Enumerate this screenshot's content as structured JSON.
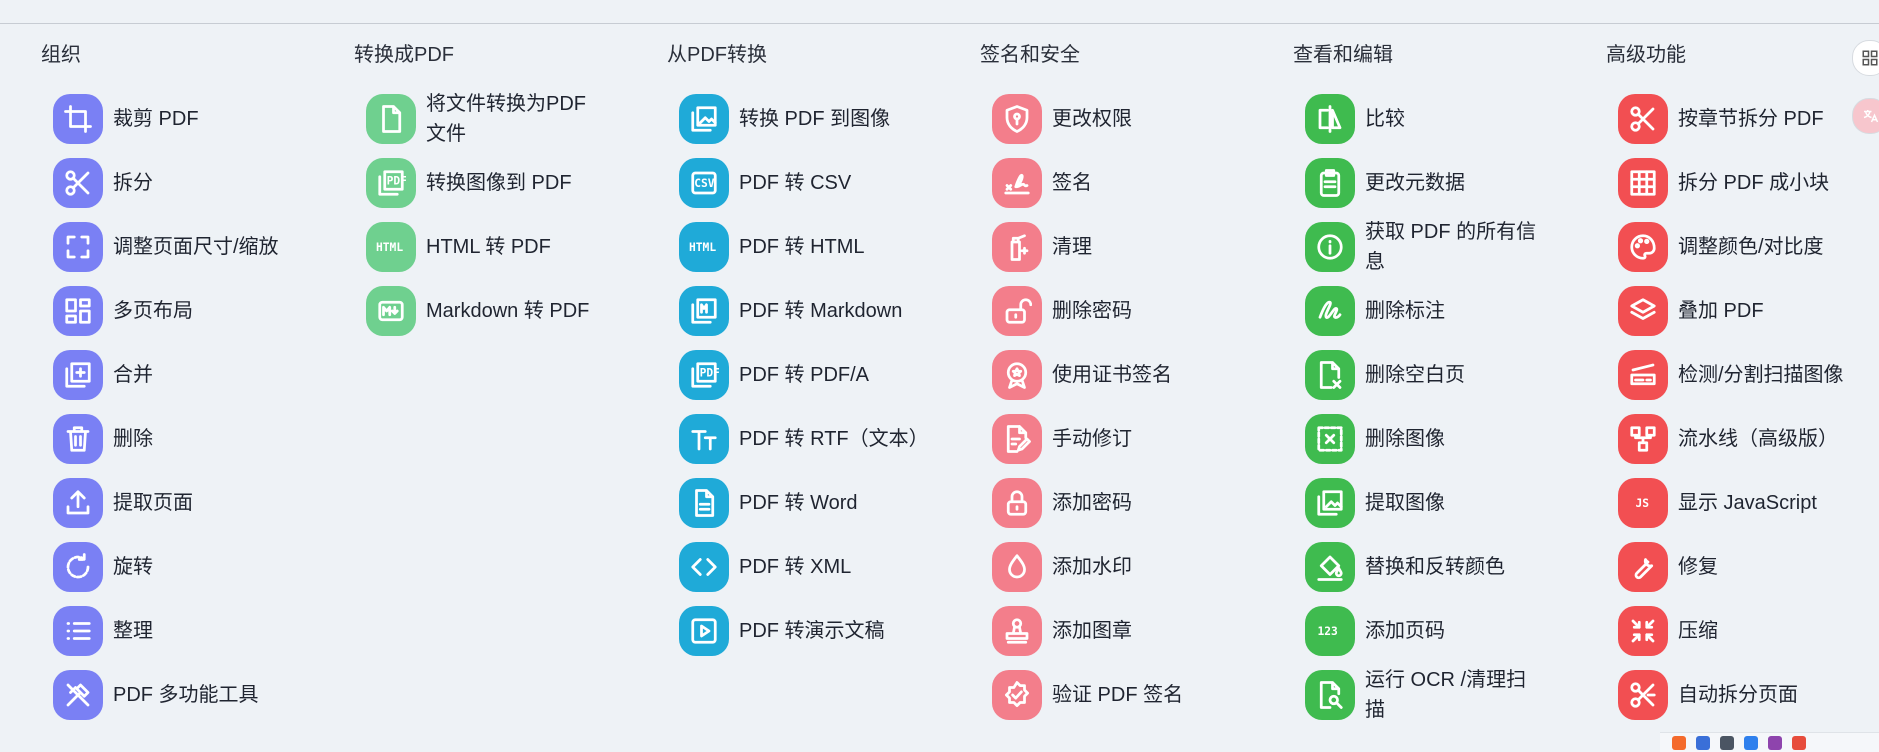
{
  "columns": [
    {
      "title": "组织",
      "items": [
        {
          "label": "裁剪 PDF",
          "icon": "crop-icon"
        },
        {
          "label": "拆分",
          "icon": "scissors-icon"
        },
        {
          "label": "调整页面尺寸/缩放",
          "icon": "fullscreen-icon"
        },
        {
          "label": "多页布局",
          "icon": "dashboard-icon"
        },
        {
          "label": "合并",
          "icon": "add-to-stack-icon"
        },
        {
          "label": "删除",
          "icon": "trash-icon"
        },
        {
          "label": "提取页面",
          "icon": "upload-icon"
        },
        {
          "label": "旋转",
          "icon": "rotate-icon"
        },
        {
          "label": "整理",
          "icon": "list-icon"
        },
        {
          "label": "PDF 多功能工具",
          "icon": "tools-icon"
        }
      ]
    },
    {
      "title": "转换成PDF",
      "items": [
        {
          "label": "将文件转换为PDF 文件",
          "icon": "file-icon"
        },
        {
          "label": "转换图像到 PDF",
          "icon": "pdf-image-icon"
        },
        {
          "label": "HTML 转 PDF",
          "icon": "html-icon"
        },
        {
          "label": "Markdown 转 PDF",
          "icon": "markdown-icon"
        }
      ]
    },
    {
      "title": "从PDF转换",
      "items": [
        {
          "label": "转换 PDF 到图像",
          "icon": "image-icon"
        },
        {
          "label": "PDF 转 CSV",
          "icon": "csv-icon"
        },
        {
          "label": "PDF 转 HTML",
          "icon": "html-icon"
        },
        {
          "label": "PDF 转 Markdown",
          "icon": "markdown-icon"
        },
        {
          "label": "PDF 转 PDF/A",
          "icon": "pdf-file-icon"
        },
        {
          "label": "PDF 转 RTF（文本）",
          "icon": "text-format-icon"
        },
        {
          "label": "PDF 转 Word",
          "icon": "document-icon"
        },
        {
          "label": "PDF 转 XML",
          "icon": "code-icon"
        },
        {
          "label": "PDF 转演示文稿",
          "icon": "play-slides-icon"
        }
      ]
    },
    {
      "title": "签名和安全",
      "items": [
        {
          "label": "更改权限",
          "icon": "shield-lock-icon"
        },
        {
          "label": "签名",
          "icon": "signature-icon"
        },
        {
          "label": "清理",
          "icon": "sanitize-icon"
        },
        {
          "label": "删除密码",
          "icon": "unlock-icon"
        },
        {
          "label": "使用证书签名",
          "icon": "badge-icon"
        },
        {
          "label": "手动修订",
          "icon": "edit-document-icon"
        },
        {
          "label": "添加密码",
          "icon": "lock-icon"
        },
        {
          "label": "添加水印",
          "icon": "water-drop-icon"
        },
        {
          "label": "添加图章",
          "icon": "stamp-icon"
        },
        {
          "label": "验证 PDF 签名",
          "icon": "verified-icon"
        }
      ]
    },
    {
      "title": "查看和编辑",
      "items": [
        {
          "label": "比较",
          "icon": "compare-icon"
        },
        {
          "label": "更改元数据",
          "icon": "clipboard-icon"
        },
        {
          "label": "获取 PDF 的所有信息",
          "icon": "info-icon"
        },
        {
          "label": "删除标注",
          "icon": "draw-icon"
        },
        {
          "label": "删除空白页",
          "icon": "blank-page-icon"
        },
        {
          "label": "删除图像",
          "icon": "remove-image-icon"
        },
        {
          "label": "提取图像",
          "icon": "images-icon"
        },
        {
          "label": "替换和反转颜色",
          "icon": "paint-bucket-icon"
        },
        {
          "label": "添加页码",
          "icon": "numbers-icon"
        },
        {
          "label": "运行 OCR /清理扫描",
          "icon": "scan-search-icon"
        }
      ]
    },
    {
      "title": "高级功能",
      "items": [
        {
          "label": "按章节拆分 PDF",
          "icon": "cut-chapter-icon"
        },
        {
          "label": "拆分 PDF 成小块",
          "icon": "grid-icon"
        },
        {
          "label": "调整颜色/对比度",
          "icon": "palette-icon"
        },
        {
          "label": "叠加 PDF",
          "icon": "layers-icon"
        },
        {
          "label": "检测/分割扫描图像",
          "icon": "scanner-icon"
        },
        {
          "label": "流水线（高级版）",
          "icon": "pipeline-icon"
        },
        {
          "label": "显示 JavaScript",
          "icon": "javascript-icon"
        },
        {
          "label": "修复",
          "icon": "wrench-icon"
        },
        {
          "label": "压缩",
          "icon": "compress-icon"
        },
        {
          "label": "自动拆分页面",
          "icon": "auto-split-icon"
        }
      ]
    }
  ],
  "colors": {
    "organize": "#7a80f4",
    "convert_to": "#6fd08f",
    "convert_from": "#1faad8",
    "security": "#f37e8b",
    "view_edit": "#3fbb4f",
    "advanced": "#f24f52"
  }
}
